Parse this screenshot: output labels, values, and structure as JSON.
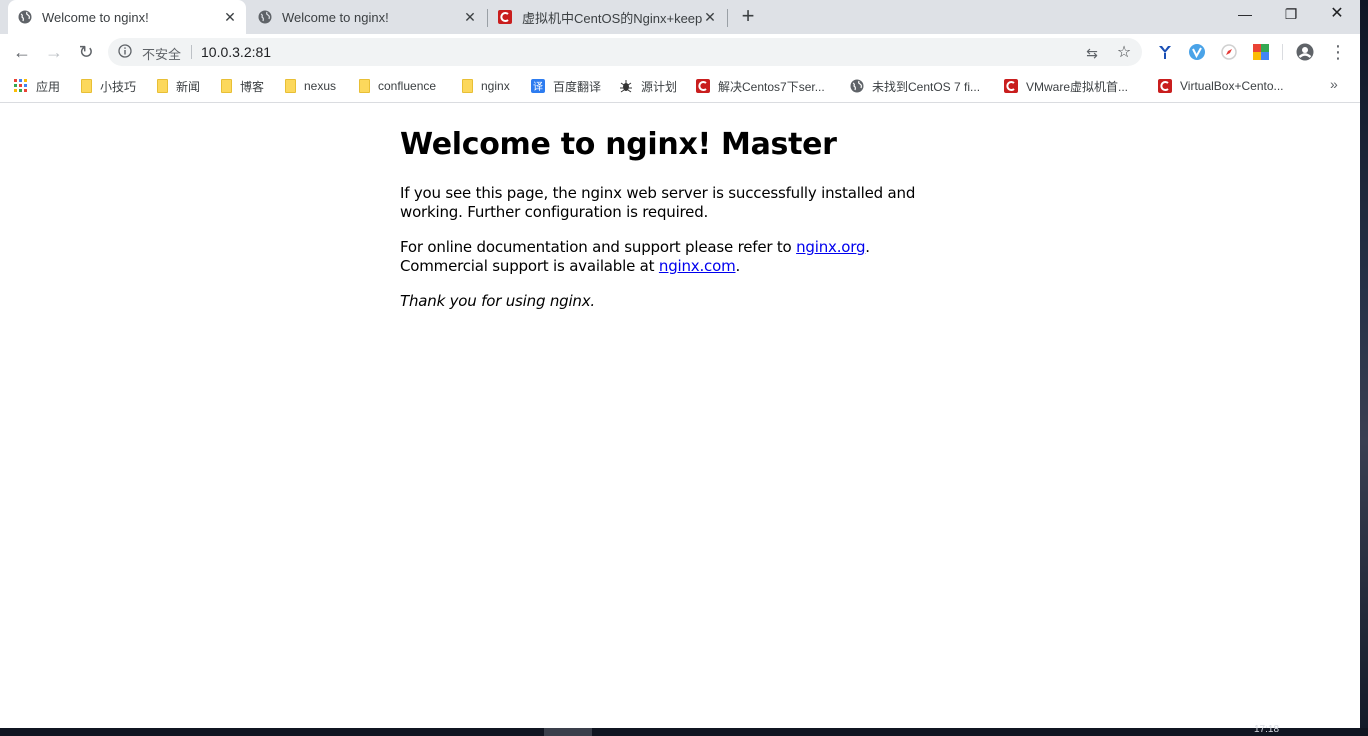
{
  "tabs": [
    {
      "title": "Welcome to nginx!",
      "icon": "globe-icon",
      "active": true
    },
    {
      "title": "Welcome to nginx!",
      "icon": "globe-icon",
      "active": false
    },
    {
      "title": "虚拟机中CentOS的Nginx+keep",
      "icon": "csdn-icon",
      "active": false
    }
  ],
  "tab_close_glyph": "✕",
  "new_tab_glyph": "+",
  "window_controls": {
    "minimize": "—",
    "maximize": "❐",
    "close": "✕"
  },
  "toolbar": {
    "back_glyph": "←",
    "forward_glyph": "→",
    "reload_glyph": "↻",
    "security_label": "不安全",
    "url": "10.0.3.2:81",
    "translate_glyph": "⇆",
    "star_glyph": "☆",
    "menu_glyph": "⋮"
  },
  "bookmarks": [
    {
      "label": "应用",
      "icon": "apps-grid-icon"
    },
    {
      "label": "小技巧",
      "icon": "folder-icon"
    },
    {
      "label": "新闻",
      "icon": "folder-icon"
    },
    {
      "label": "博客",
      "icon": "folder-icon"
    },
    {
      "label": "nexus",
      "icon": "folder-icon"
    },
    {
      "label": "confluence",
      "icon": "folder-icon"
    },
    {
      "label": "nginx",
      "icon": "folder-icon"
    },
    {
      "label": "百度翻译",
      "icon": "baidu-translate-icon"
    },
    {
      "label": "源计划",
      "icon": "bug-icon"
    },
    {
      "label": "解决Centos7下ser...",
      "icon": "csdn-icon"
    },
    {
      "label": "未找到CentOS 7 fi...",
      "icon": "globe-icon"
    },
    {
      "label": "VMware虚拟机首...",
      "icon": "csdn-icon"
    },
    {
      "label": "VirtualBox+Cento...",
      "icon": "csdn-icon"
    }
  ],
  "bookmarks_more_glyph": "»",
  "page": {
    "heading": "Welcome to nginx! Master",
    "para1": "If you see this page, the nginx web server is successfully installed and working. Further configuration is required.",
    "para2_before": "For online documentation and support please refer to ",
    "link1": "nginx.org",
    "para2_middle": ".",
    "para2_line2": "Commercial support is available at ",
    "link2": "nginx.com",
    "para2_end": ".",
    "para3": "Thank you for using nginx."
  },
  "taskbar": {
    "clock": "17:18"
  },
  "colors": {
    "tabstrip": "#dee1e6",
    "link": "#0000ee",
    "csdn": "#c91e1e",
    "folder": "#fcd85c"
  }
}
